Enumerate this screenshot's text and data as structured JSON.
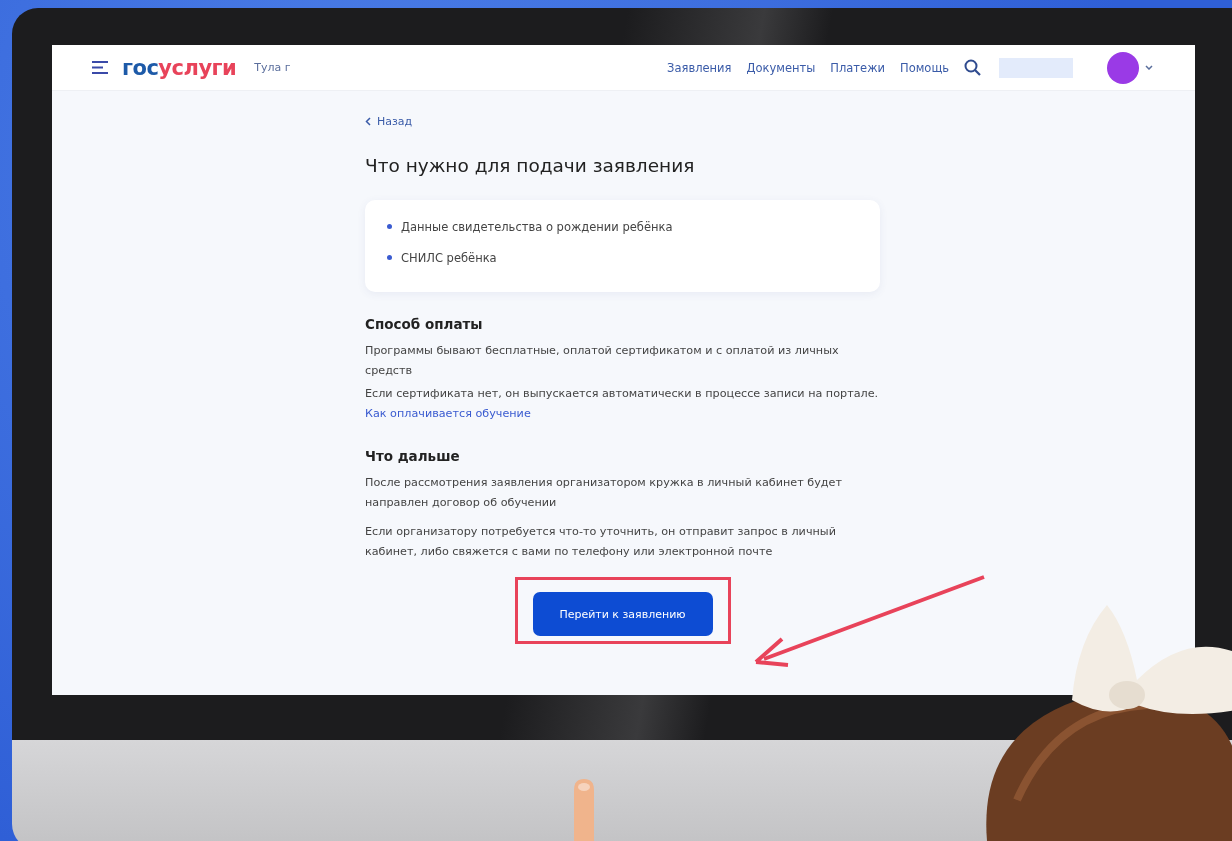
{
  "header": {
    "logo_parts": [
      {
        "text": "гос",
        "color": "#1d5aa8"
      },
      {
        "text": "услуги",
        "color": "#e8435a"
      }
    ],
    "city": "Тула г",
    "nav": [
      "Заявления",
      "Документы",
      "Платежи",
      "Помощь"
    ]
  },
  "back_link": "Назад",
  "title": "Что нужно для подачи заявления",
  "requirements": [
    "Данные свидетельства о рождении ребёнка",
    "СНИЛС ребёнка"
  ],
  "sections": [
    {
      "heading": "Способ оплаты",
      "paragraphs": [
        {
          "text": "Программы бывают бесплатные, оплатой сертификатом и с оплатой из личных средств"
        },
        {
          "text": "Если сертификата нет, он выпускается автоматически в процессе записи на портале.",
          "link": "Как оплачивается обучение"
        }
      ]
    },
    {
      "heading": "Что дальше",
      "paragraphs": [
        {
          "text": "После рассмотрения заявления организатором кружка в личный кабинет будет направлен договор об обучении"
        },
        {
          "text": "Если организатору потребуется что-то уточнить, он отправит запрос в личный кабинет, либо свяжется с вами по телефону или электронной почте"
        }
      ]
    }
  ],
  "primary_button": "Перейти к заявлению"
}
